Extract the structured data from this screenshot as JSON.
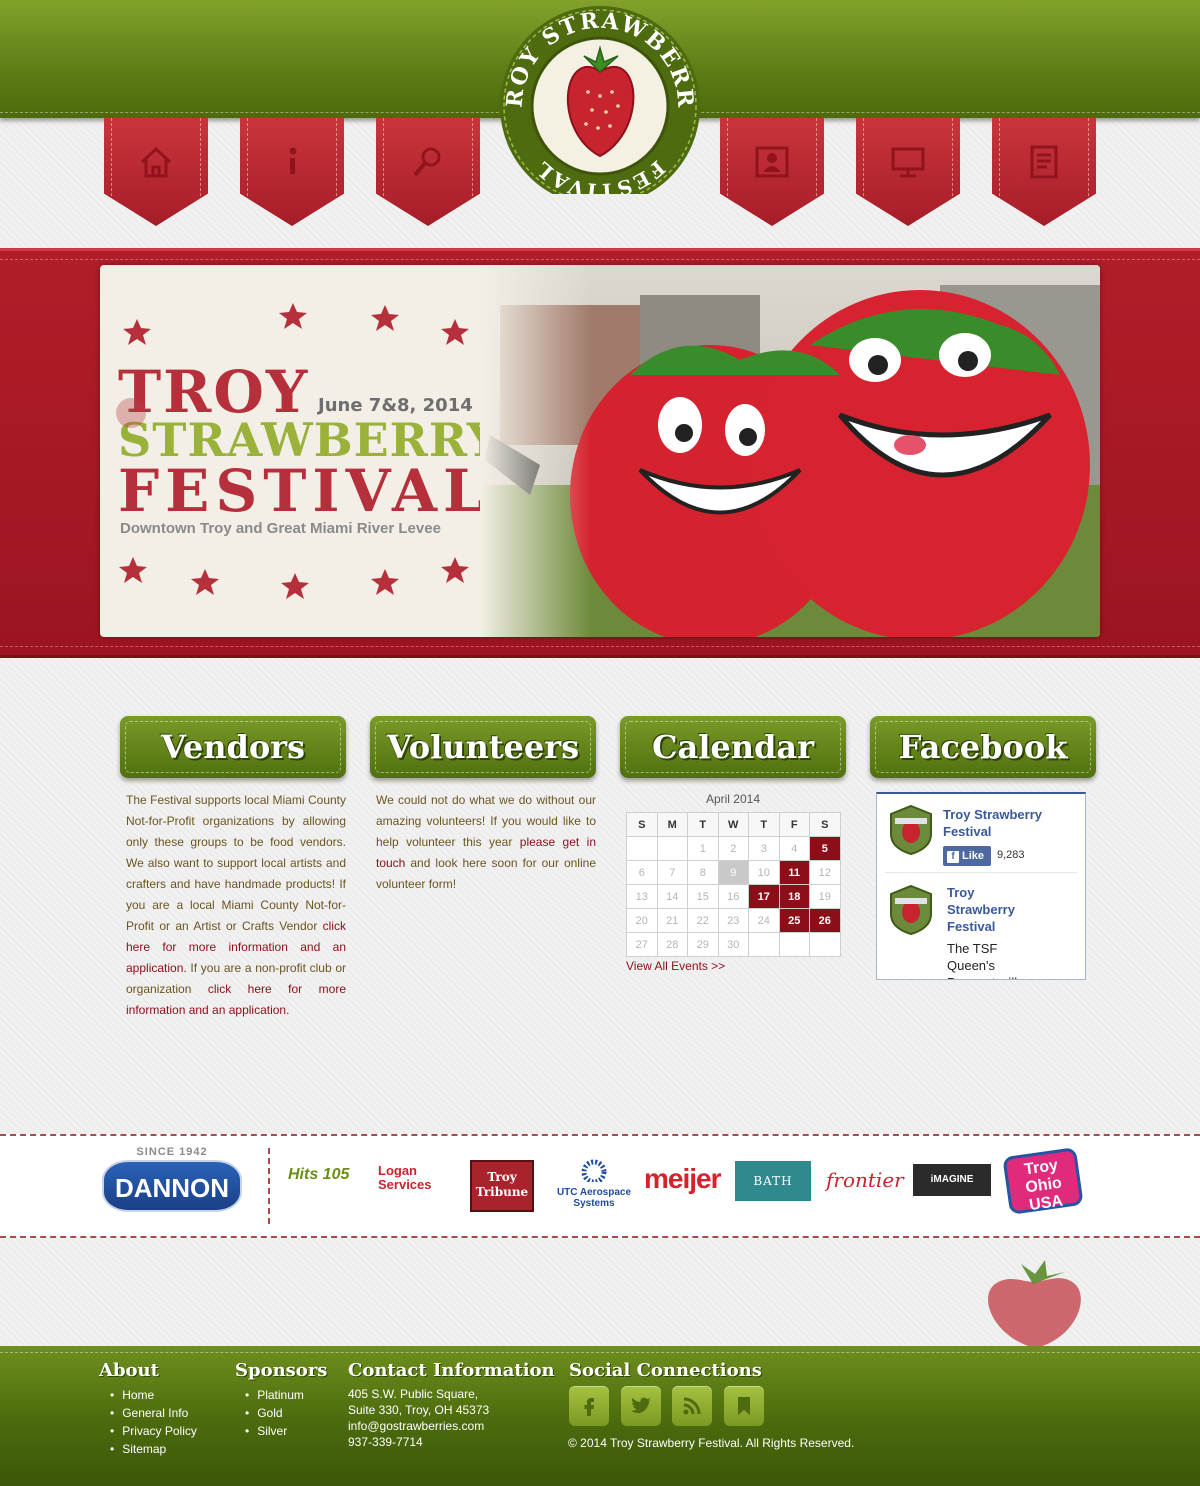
{
  "logo": {
    "text_top": "TROY",
    "text_right": "STRAWBERRY",
    "text_left": "FESTIVAL"
  },
  "nav": [
    {
      "icon": "home-icon"
    },
    {
      "icon": "info-icon"
    },
    {
      "icon": "search-icon"
    },
    {
      "icon": "contact-icon"
    },
    {
      "icon": "monitor-icon"
    },
    {
      "icon": "document-icon"
    }
  ],
  "hero": {
    "title_line1": "TROY",
    "title_line2": "STRAWBERRY",
    "title_line3": "FESTIVAL",
    "date": "June 7&8, 2014",
    "venue": "Downtown Troy and Great Miami River Levee"
  },
  "columns": {
    "vendors": {
      "heading": "Vendors",
      "text_1": "The Festival supports local Miami County Not-for-Profit organizations by allowing only these groups to be food vendors. We also want to support local artists and crafters and have handmade products! If you are a local Miami County Not-for-Profit or an Artist or Crafts Vendor ",
      "link_1": "click here for more information and an application.",
      "text_2": " If you are a non-profit club or organization ",
      "link_2": "click here for more information and an application."
    },
    "volunteers": {
      "heading": "Volunteers",
      "text_1": "We could not do what we do without our amazing volunteers! If you would like to help volunteer this year ",
      "link_1": "please get in touch",
      "text_2": " and look here soon for our online volunteer form!"
    },
    "calendar": {
      "heading": "Calendar",
      "month": "April 2014",
      "weekdays": [
        "S",
        "M",
        "T",
        "W",
        "T",
        "F",
        "S"
      ],
      "weeks": [
        [
          "",
          "",
          "1",
          "2",
          "3",
          "4",
          "5"
        ],
        [
          "6",
          "7",
          "8",
          "9",
          "10",
          "11",
          "12"
        ],
        [
          "13",
          "14",
          "15",
          "16",
          "17",
          "18",
          "19"
        ],
        [
          "20",
          "21",
          "22",
          "23",
          "24",
          "25",
          "26"
        ],
        [
          "27",
          "28",
          "29",
          "30",
          "",
          "",
          ""
        ]
      ],
      "event_days": [
        "5",
        "11",
        "17",
        "18",
        "25",
        "26"
      ],
      "today": "9",
      "view_all": "View All Events >>"
    },
    "facebook": {
      "heading": "Facebook",
      "page_name": "Troy Strawberry Festival",
      "like_label": "Like",
      "like_count": "9,283",
      "post_author": "Troy Strawberry Festival",
      "post_text": "The TSF Queen's Pageant will"
    }
  },
  "sponsors": [
    "DANNON",
    "SINCE 1942",
    "Hits 105",
    "Logan Services",
    "Troy Tribune",
    "UTC Aerospace Systems",
    "meijer",
    "BATH FITTER",
    "frontier",
    "iMAGINE NETWORKS",
    "Troy Ohio USA"
  ],
  "footer": {
    "about": {
      "heading": "About",
      "items": [
        "Home",
        "General Info",
        "Privacy Policy",
        "Sitemap"
      ]
    },
    "sponsors": {
      "heading": "Sponsors",
      "items": [
        "Platinum",
        "Gold",
        "Silver"
      ]
    },
    "contact": {
      "heading": "Contact Information",
      "line1": "405 S.W. Public Square,",
      "line2": "Suite 330, Troy, OH 45373",
      "email": "info@gostrawberries.com",
      "phone": "937-339-7714"
    },
    "social": {
      "heading": "Social Connections",
      "icons": [
        "facebook-icon",
        "twitter-icon",
        "rss-icon",
        "bookmark-icon"
      ]
    },
    "copyright": "© 2014 Troy Strawberry Festival. All Rights Reserved."
  },
  "colors": {
    "green": "#5f7d16",
    "red": "#a61d27",
    "link": "#8b0e18"
  }
}
